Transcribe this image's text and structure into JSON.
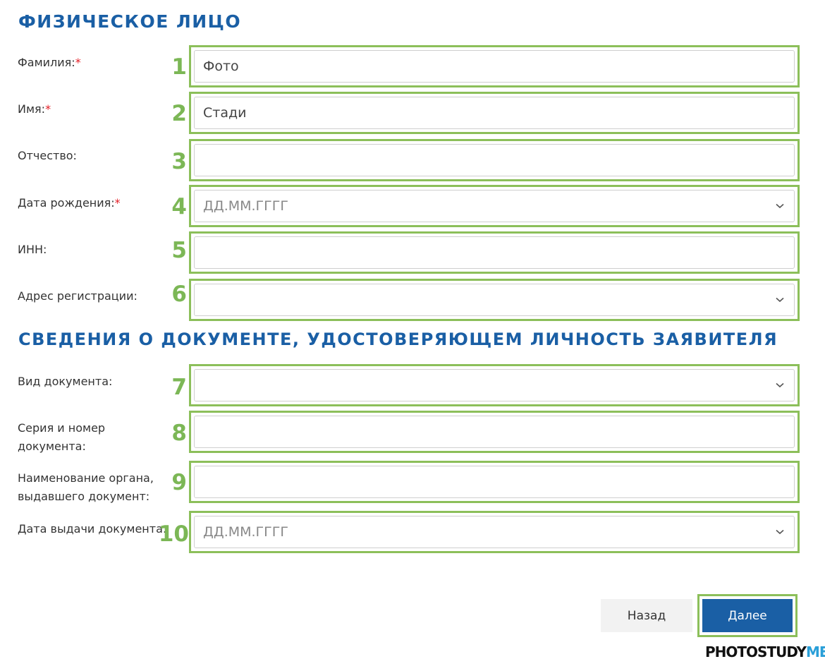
{
  "sections": {
    "personal_title": "ФИЗИЧЕСКОЕ ЛИЦО",
    "document_title": "СВЕДЕНИЯ О ДОКУМЕНТЕ, УДОСТОВЕРЯЮЩЕМ ЛИЧНОСТЬ ЗАЯВИТЕЛЯ"
  },
  "required_mark": "*",
  "fields": [
    {
      "number": "1",
      "label": "Фамилия:",
      "required": true,
      "value": "Фото",
      "placeholder": "",
      "type": "text"
    },
    {
      "number": "2",
      "label": "Имя:",
      "required": true,
      "value": "Стади",
      "placeholder": "",
      "type": "text"
    },
    {
      "number": "3",
      "label": "Отчество:",
      "required": false,
      "value": "",
      "placeholder": "",
      "type": "text"
    },
    {
      "number": "4",
      "label": "Дата рождения:",
      "required": true,
      "value": "",
      "placeholder": "ДД.ММ.ГГГГ",
      "type": "select"
    },
    {
      "number": "5",
      "label": "ИНН:",
      "required": false,
      "value": "",
      "placeholder": "",
      "type": "text"
    },
    {
      "number": "6",
      "label": "Адрес регистрации:",
      "required": false,
      "value": "",
      "placeholder": "",
      "type": "select"
    },
    {
      "number": "7",
      "label": "Вид документа:",
      "required": false,
      "value": "",
      "placeholder": "",
      "type": "select"
    },
    {
      "number": "8",
      "label": "Серия и номер документа:",
      "required": false,
      "value": "",
      "placeholder": "",
      "type": "text"
    },
    {
      "number": "9",
      "label": "Наименование органа, выдавшего документ:",
      "required": false,
      "value": "",
      "placeholder": "",
      "type": "text"
    },
    {
      "number": "10",
      "label": "Дата выдачи документа:",
      "required": false,
      "value": "",
      "placeholder": "ДД.ММ.ГГГГ",
      "type": "select"
    }
  ],
  "buttons": {
    "back_label": "Назад",
    "next_label": "Далее"
  },
  "watermark": {
    "part1": "PHOTOSTUDY",
    "part2": "ME"
  },
  "colors": {
    "accent": "#1a5fa5",
    "highlight": "#8cbf5a",
    "required": "#e31b23",
    "watermark_accent": "#2a9fd8"
  },
  "icons": {
    "dropdown": "chevron-down-icon"
  }
}
